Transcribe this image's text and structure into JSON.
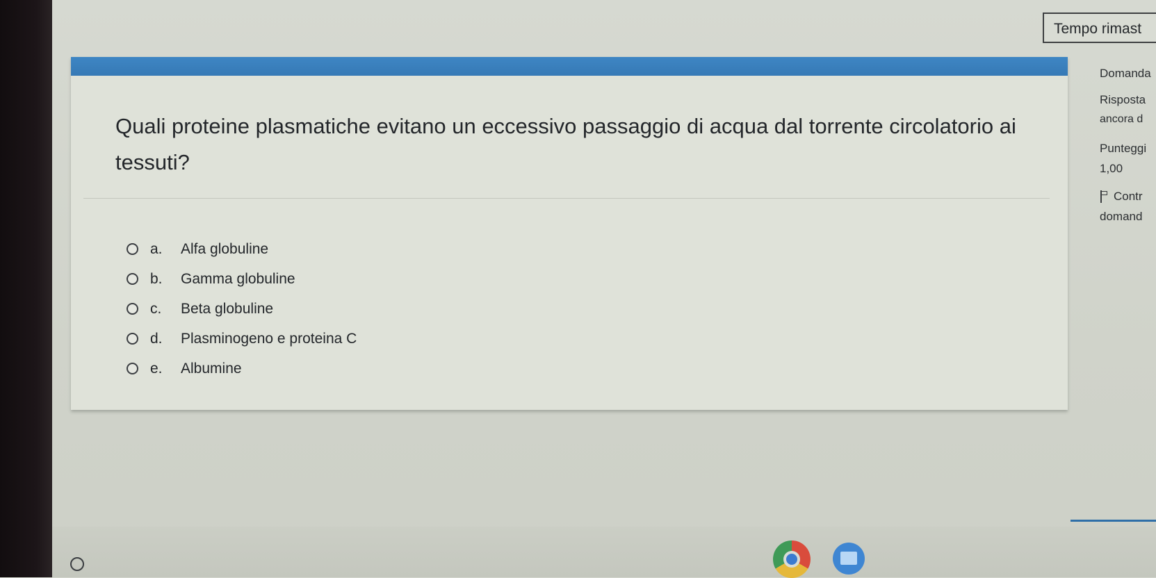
{
  "timer": {
    "label": "Tempo rimast"
  },
  "info_panel": {
    "question_label": "Domanda",
    "answer_status_line1": "Risposta",
    "answer_status_line2": "ancora d",
    "score_label": "Punteggi",
    "score_value": "1,00",
    "flag_label_line1": "Contr",
    "flag_label_line2": "domand"
  },
  "question": {
    "text": "Quali proteine plasmatiche evitano un eccessivo passaggio di acqua dal torrente circolatorio ai tessuti?",
    "answers": [
      {
        "letter": "a.",
        "label": "Alfa globuline"
      },
      {
        "letter": "b.",
        "label": "Gamma globuline"
      },
      {
        "letter": "c.",
        "label": "Beta globuline"
      },
      {
        "letter": "d.",
        "label": "Plasminogeno e proteina C"
      },
      {
        "letter": "e.",
        "label": "Albumine"
      }
    ]
  },
  "taskbar": {
    "icons": [
      "launcher-icon",
      "chrome-icon",
      "files-icon"
    ],
    "accent": "#2f6fa8"
  },
  "colors": {
    "header_bar": "#3679b5",
    "card_bg": "#dfe2d9",
    "page_bg": "#d3d6cd"
  }
}
